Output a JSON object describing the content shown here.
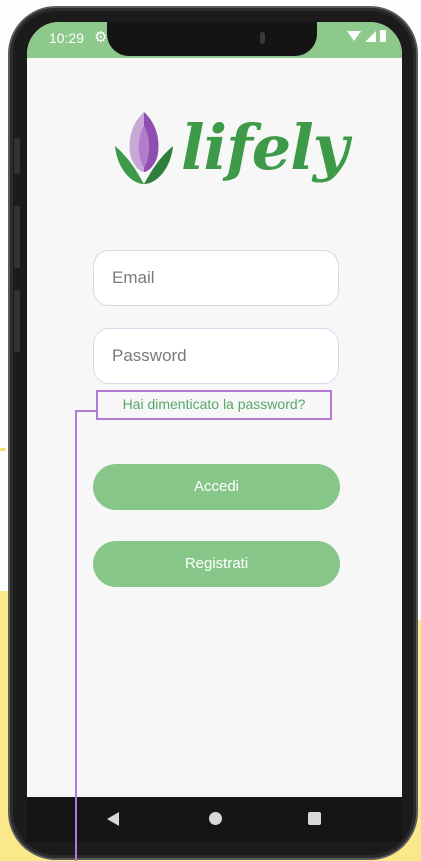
{
  "status_bar": {
    "time": "10:29",
    "settings_icon": "gear-icon",
    "icons_right": [
      "wifi-icon",
      "signal-icon",
      "battery-icon"
    ]
  },
  "logo": {
    "text": "lifely",
    "icon": "tulip-logo-icon"
  },
  "login_form": {
    "email_placeholder": "Email",
    "email_value": "",
    "password_placeholder": "Password",
    "password_value": "",
    "forgot_password_label": "Hai dimenticato la password?",
    "login_button_label": "Accedi",
    "register_button_label": "Registrati"
  },
  "nav_bar": {
    "icons": [
      "back-icon",
      "home-icon",
      "recent-apps-icon"
    ]
  },
  "colors": {
    "brand_green": "#3c9a49",
    "button_green": "#87c689",
    "status_bar_green": "#8cc98a",
    "highlight_purple": "#b57ad4",
    "background_yellow": "#fbe88a"
  }
}
